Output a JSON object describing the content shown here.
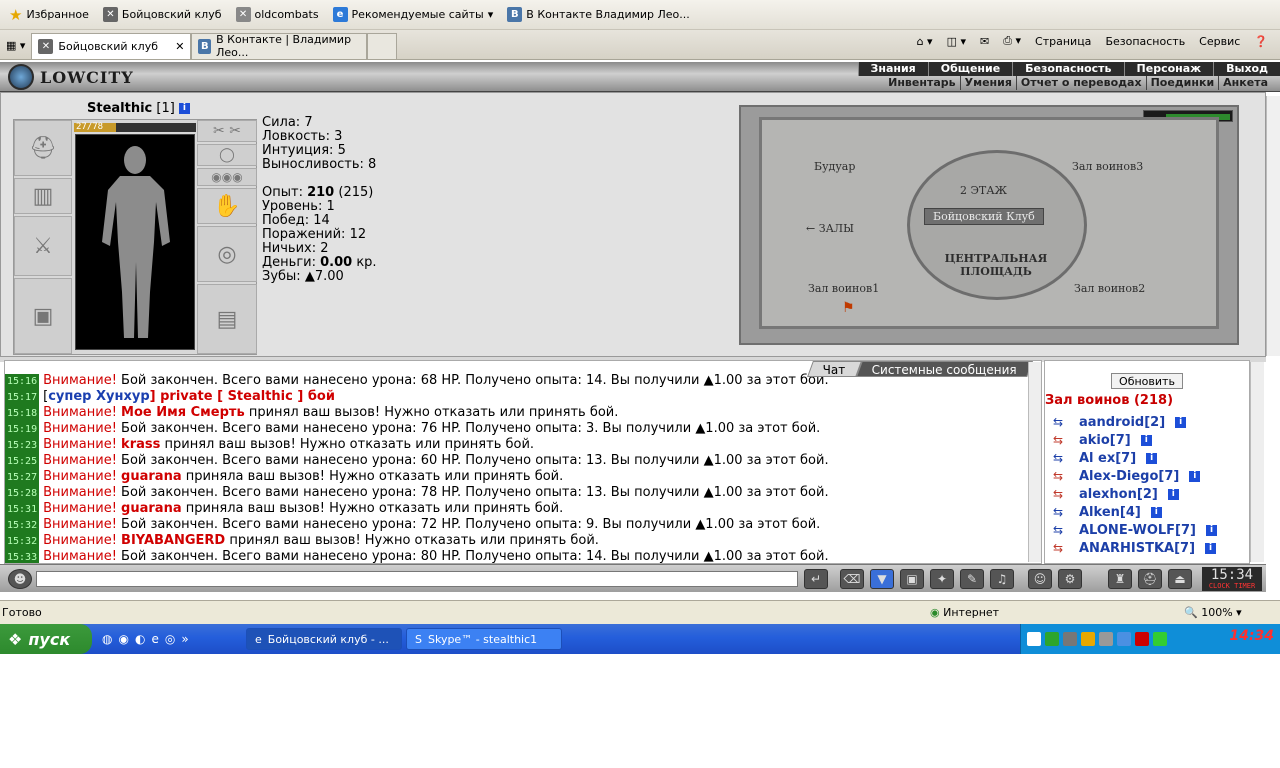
{
  "browser": {
    "favorites_label": "Избранное",
    "links": [
      "Бойцовский клуб",
      "oldcombats",
      "Рекомендуемые сайты",
      "В Контакте  Владимир Лео..."
    ],
    "tabs": [
      "Бойцовский клуб",
      "В Контакте | Владимир Лео..."
    ],
    "tools": [
      "Страница",
      "Безопасность",
      "Сервис"
    ]
  },
  "game": {
    "logo": "LOWCITY",
    "menu_top": [
      "Знания",
      "Общение",
      "Безопасность",
      "Персонаж",
      "Выход"
    ],
    "menu_sub": [
      "Инвентарь",
      "Умения",
      "Отчет о переводах",
      "Поединки",
      "Анкета"
    ]
  },
  "character": {
    "name": "Stealthic",
    "level": "[1]",
    "hp": "27/78",
    "hp_fraction": 0.346,
    "stats": [
      "Сила: 7",
      "Ловкость: 3",
      "Интуиция: 5",
      "Выносливость: 8"
    ],
    "exp_label": "Опыт: ",
    "exp_value": "210",
    "exp_next": " (215)",
    "level_line": "Уровень: 1",
    "wins": "Побед: 14",
    "losses": "Поражений: 12",
    "draws": "Ничьих: 2",
    "money_label": "Деньги: ",
    "money_value": "0.00",
    "money_unit": " кр.",
    "teeth": "Зубы: ▲7.00"
  },
  "map": {
    "boudoir": "Будуар",
    "hall3": "Зал воинов3",
    "floor2": "2 ЭТАЖ",
    "club": "Бойцовский Клуб",
    "halls": "← ЗАЛЫ",
    "central": "ЦЕНТРАЛЬНАЯ ПЛОЩАДЬ",
    "hall1": "Зал воинов1",
    "hall2": "Зал воинов2"
  },
  "chat": {
    "tab_chat": "Чат",
    "tab_system": "Системные сообщения",
    "lines": [
      {
        "t": "15:16",
        "pre": "Внимание! ",
        "nick": "",
        "txt": "Бой закончен. Всего вами нанесено урона: 68 HP. Получено опыта: 14. Вы получили ▲1.00 за этот бой."
      },
      {
        "t": "15:17",
        "pre": "[",
        "nick": "супер Хунхур",
        "txt": "] private [ Stealthic ] бой"
      },
      {
        "t": "15:18",
        "pre": "Внимание! ",
        "nick": "Мое Имя Смерть",
        "txt": " принял ваш вызов! Нужно отказать или принять бой."
      },
      {
        "t": "15:19",
        "pre": "Внимание! ",
        "nick": "",
        "txt": "Бой закончен. Всего вами нанесено урона: 76 HP. Получено опыта: 3. Вы получили ▲1.00 за этот бой."
      },
      {
        "t": "15:23",
        "pre": "Внимание! ",
        "nick": "krass",
        "txt": " принял ваш вызов! Нужно отказать или принять бой."
      },
      {
        "t": "15:25",
        "pre": "Внимание! ",
        "nick": "",
        "txt": "Бой закончен. Всего вами нанесено урона: 60 HP. Получено опыта: 13. Вы получили ▲1.00 за этот бой."
      },
      {
        "t": "15:27",
        "pre": "Внимание! ",
        "nick": "guarana",
        "txt": " приняла ваш вызов! Нужно отказать или принять бой."
      },
      {
        "t": "15:28",
        "pre": "Внимание! ",
        "nick": "",
        "txt": "Бой закончен. Всего вами нанесено урона: 78 HP. Получено опыта: 13. Вы получили ▲1.00 за этот бой."
      },
      {
        "t": "15:31",
        "pre": "Внимание! ",
        "nick": "guarana",
        "txt": " приняла ваш вызов! Нужно отказать или принять бой."
      },
      {
        "t": "15:32",
        "pre": "Внимание! ",
        "nick": "",
        "txt": "Бой закончен. Всего вами нанесено урона: 72 HP. Получено опыта: 9. Вы получили ▲1.00 за этот бой."
      },
      {
        "t": "15:32",
        "pre": "Внимание! ",
        "nick": "BIYABANGERD",
        "txt": " принял ваш вызов! Нужно отказать или принять бой."
      },
      {
        "t": "15:33",
        "pre": "Внимание! ",
        "nick": "",
        "txt": "Бой закончен. Всего вами нанесено урона: 80 HP. Получено опыта: 14. Вы получили ▲1.00 за этот бой."
      }
    ]
  },
  "users": {
    "refresh": "Обновить",
    "hall": "Зал воинов (218)",
    "list": [
      "aandroid[2]",
      "akio[7]",
      "Al ex[7]",
      "Alex-Diego[7]",
      "alexhon[2]",
      "Alken[4]",
      "ALONE-WOLF[7]",
      "ANARHISTKA[7]"
    ]
  },
  "clock": {
    "time": "15:34",
    "labels": "CLOCK TIMER"
  },
  "status": {
    "text": "Готово",
    "zone": "Интернет",
    "zoom": "100%"
  },
  "taskbar": {
    "start": "пуск",
    "windows": [
      "Бойцовский клуб - ...",
      "Skype™ - stealthic1"
    ],
    "tray_time": "14:34"
  }
}
